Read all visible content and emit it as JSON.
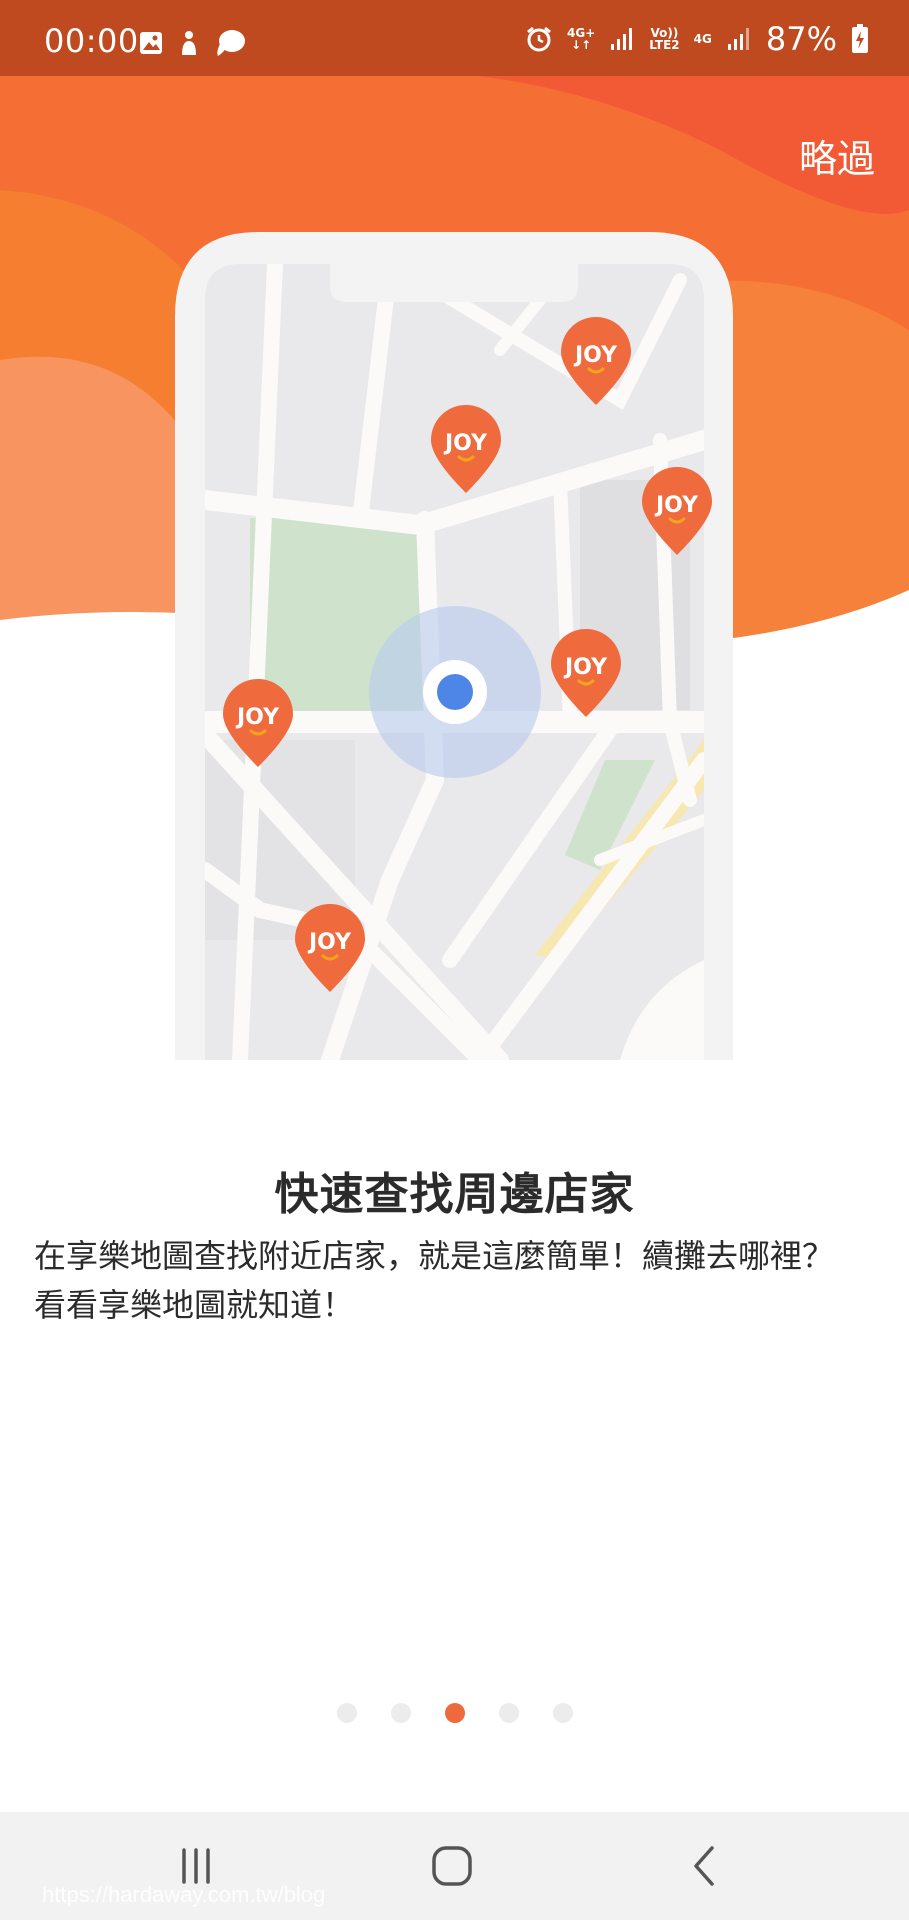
{
  "status_bar": {
    "time": "00:00",
    "network_1": "4G+",
    "network_2_top": "Vo))",
    "network_2_bottom": "LTE2",
    "network_3": "4G",
    "battery": "87%"
  },
  "header": {
    "skip_label": "略過"
  },
  "illustration": {
    "pin_label": "JOY",
    "colors": {
      "pin": "#ef6a3d",
      "user_dot": "#4d86e6",
      "accent": "#f06a35"
    }
  },
  "content": {
    "title": "快速查找周邊店家",
    "description_line1": "在享樂地圖查找附近店家，就是這麼簡單！續攤去哪裡？",
    "description_line2": "看看享樂地圖就知道！"
  },
  "pager": {
    "total": 5,
    "active_index": 2
  },
  "watermark": "https://hardaway.com.tw/blog"
}
